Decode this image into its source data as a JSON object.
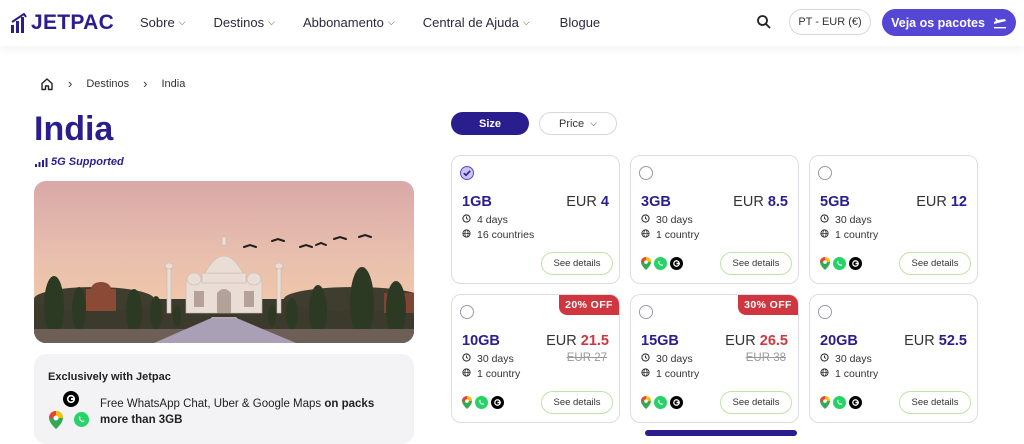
{
  "header": {
    "brand": "JETPAC",
    "nav": [
      {
        "label": "Sobre",
        "has_menu": true
      },
      {
        "label": "Destinos",
        "has_menu": true
      },
      {
        "label": "Abbonamento",
        "has_menu": true
      },
      {
        "label": "Central de Ajuda",
        "has_menu": true
      },
      {
        "label": "Blogue",
        "has_menu": false
      }
    ],
    "locale": "PT - EUR (€)",
    "cta": "Veja os pacotes"
  },
  "breadcrumb": [
    "Destinos",
    "India"
  ],
  "page": {
    "title": "India",
    "network_badge": "5G Supported"
  },
  "promo": {
    "title": "Exclusively with Jetpac",
    "text_plain": "Free WhatsApp Chat, Uber & Google Maps ",
    "text_bold": "on packs more than 3GB"
  },
  "filters": {
    "size": "Size",
    "price": "Price"
  },
  "packages": [
    {
      "size": "1GB",
      "currency": "EUR",
      "price": "4",
      "old_price": "",
      "discount": "",
      "duration": "4 days",
      "coverage": "16 countries",
      "selected": true,
      "apps": false,
      "details": "See details"
    },
    {
      "size": "3GB",
      "currency": "EUR",
      "price": "8.5",
      "old_price": "",
      "discount": "",
      "duration": "30 days",
      "coverage": "1 country",
      "selected": false,
      "apps": true,
      "details": "See details"
    },
    {
      "size": "5GB",
      "currency": "EUR",
      "price": "12",
      "old_price": "",
      "discount": "",
      "duration": "30 days",
      "coverage": "1 country",
      "selected": false,
      "apps": true,
      "details": "See details"
    },
    {
      "size": "10GB",
      "currency": "EUR",
      "price": "21.5",
      "old_price": "EUR 27",
      "discount": "20% OFF",
      "duration": "30 days",
      "coverage": "1 country",
      "selected": false,
      "apps": true,
      "details": "See details"
    },
    {
      "size": "15GB",
      "currency": "EUR",
      "price": "26.5",
      "old_price": "EUR 38",
      "discount": "30% OFF",
      "duration": "30 days",
      "coverage": "1 country",
      "selected": false,
      "apps": true,
      "details": "See details"
    },
    {
      "size": "20GB",
      "currency": "EUR",
      "price": "52.5",
      "old_price": "",
      "discount": "",
      "duration": "30 days",
      "coverage": "1 country",
      "selected": false,
      "apps": true,
      "details": "See details"
    }
  ],
  "colors": {
    "brand": "#2a1e8f",
    "accent": "#5546d6",
    "sale": "#d0363f",
    "details_border": "#bfe3a5"
  },
  "icons": [
    "logo-bars-icon",
    "chevron-down-icon",
    "search-icon",
    "plane-icon",
    "home-icon",
    "chevron-right-icon",
    "signal-icon",
    "clock-icon",
    "globe-icon",
    "google-maps-icon",
    "whatsapp-icon",
    "uber-icon",
    "check-icon"
  ]
}
